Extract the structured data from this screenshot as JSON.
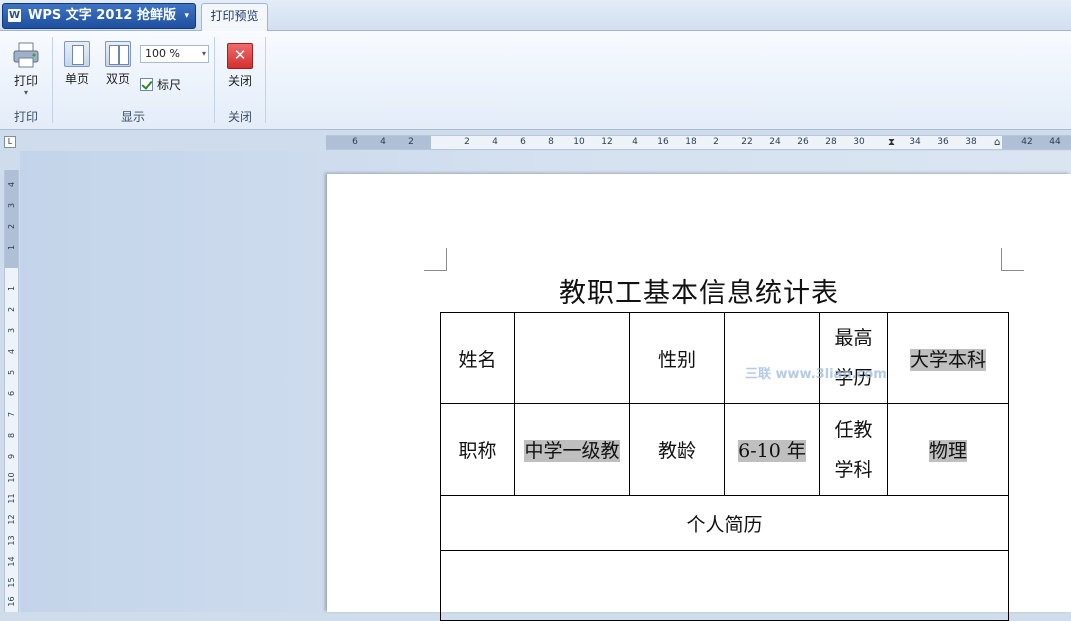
{
  "app": {
    "title": "WPS 文字 2012 抢鲜版",
    "logo_letter": "W",
    "caret": "▾"
  },
  "tabs": [
    {
      "label": "打印预览",
      "active": true
    }
  ],
  "ribbon": {
    "print_group": {
      "button_label": "打印",
      "caret": "▾",
      "group_label": "打印"
    },
    "display_group": {
      "single_page_label": "单页",
      "double_page_label": "双页",
      "zoom_value": "100 %",
      "ruler_checkbox_label": "标尺",
      "ruler_checked": true,
      "group_label": "显示"
    },
    "close_group": {
      "button_label": "关闭",
      "icon_glyph": "✕",
      "group_label": "关闭"
    }
  },
  "ruler": {
    "corner_glyph": "L",
    "horizontal_ticks": [
      "6",
      "4",
      "2",
      "2",
      "4",
      "6",
      "8",
      "10",
      "12",
      "4",
      "16",
      "18",
      "2",
      "22",
      "24",
      "26",
      "28",
      "30",
      "34",
      "36",
      "38",
      "42",
      "44"
    ],
    "vertical_ticks": [
      "4",
      "3",
      "2",
      "1",
      "1",
      "2",
      "3",
      "4",
      "5",
      "6",
      "7",
      "8",
      "9",
      "10",
      "11",
      "12",
      "13",
      "14",
      "15",
      "16"
    ]
  },
  "document": {
    "title": "教职工基本信息统计表",
    "watermark": "三联 www.3lian.com",
    "rows": [
      [
        "姓名",
        "",
        "性别",
        "",
        "最高\n学历",
        "大学本科"
      ],
      [
        "职称",
        "中学一级教",
        "教龄",
        "6-10 年",
        "任教\n学科",
        "物理"
      ],
      [
        "个人简历"
      ]
    ]
  },
  "colors": {
    "accent": "#1f4f9f",
    "highlight": "#bfbfbf",
    "close_red": "#d32f2f"
  }
}
